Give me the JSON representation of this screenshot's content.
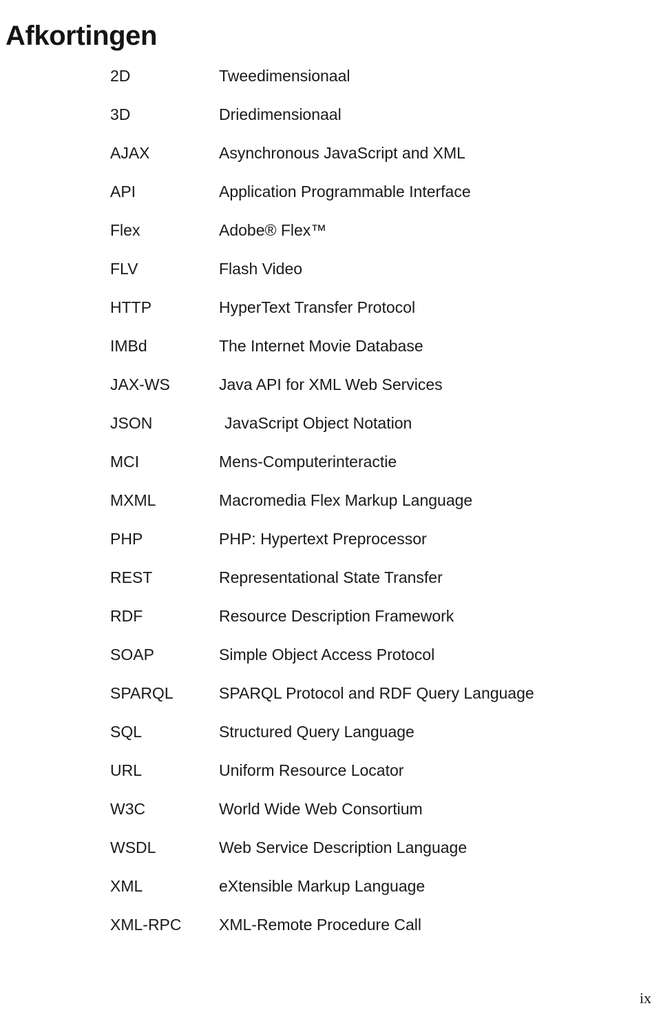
{
  "document": {
    "title": "Afkortingen",
    "page_number": "ix"
  },
  "abbreviations": [
    {
      "term": "2D",
      "definition": "Tweedimensionaal"
    },
    {
      "term": "3D",
      "definition": "Driedimensionaal"
    },
    {
      "term": "AJAX",
      "definition": "Asynchronous JavaScript and XML"
    },
    {
      "term": "API",
      "definition": "Application Programmable Interface"
    },
    {
      "term": "Flex",
      "definition": "Adobe® Flex™"
    },
    {
      "term": "FLV",
      "definition": "Flash Video"
    },
    {
      "term": "HTTP",
      "definition": "HyperText Transfer Protocol"
    },
    {
      "term": "IMBd",
      "definition": "The Internet Movie Database"
    },
    {
      "term": "JAX-WS",
      "definition": "Java API for XML Web Services"
    },
    {
      "term": "JSON",
      "definition": "JavaScript Object Notation",
      "indented": true
    },
    {
      "term": "MCI",
      "definition": "Mens-Computerinteractie"
    },
    {
      "term": "MXML",
      "definition": "Macromedia Flex Markup Language"
    },
    {
      "term": "PHP",
      "definition": "PHP: Hypertext Preprocessor"
    },
    {
      "term": "REST",
      "definition": "Representational State Transfer"
    },
    {
      "term": "RDF",
      "definition": "Resource Description Framework"
    },
    {
      "term": "SOAP",
      "definition": "Simple Object Access Protocol"
    },
    {
      "term": "SPARQL",
      "definition": "SPARQL Protocol and RDF Query Language"
    },
    {
      "term": "SQL",
      "definition": "Structured Query Language"
    },
    {
      "term": "URL",
      "definition": "Uniform Resource Locator"
    },
    {
      "term": "W3C",
      "definition": "World Wide Web Consortium"
    },
    {
      "term": "WSDL",
      "definition": "Web Service Description Language"
    },
    {
      "term": "XML",
      "definition": "eXtensible Markup Language"
    },
    {
      "term": "XML-RPC",
      "definition": "XML-Remote Procedure Call"
    }
  ]
}
